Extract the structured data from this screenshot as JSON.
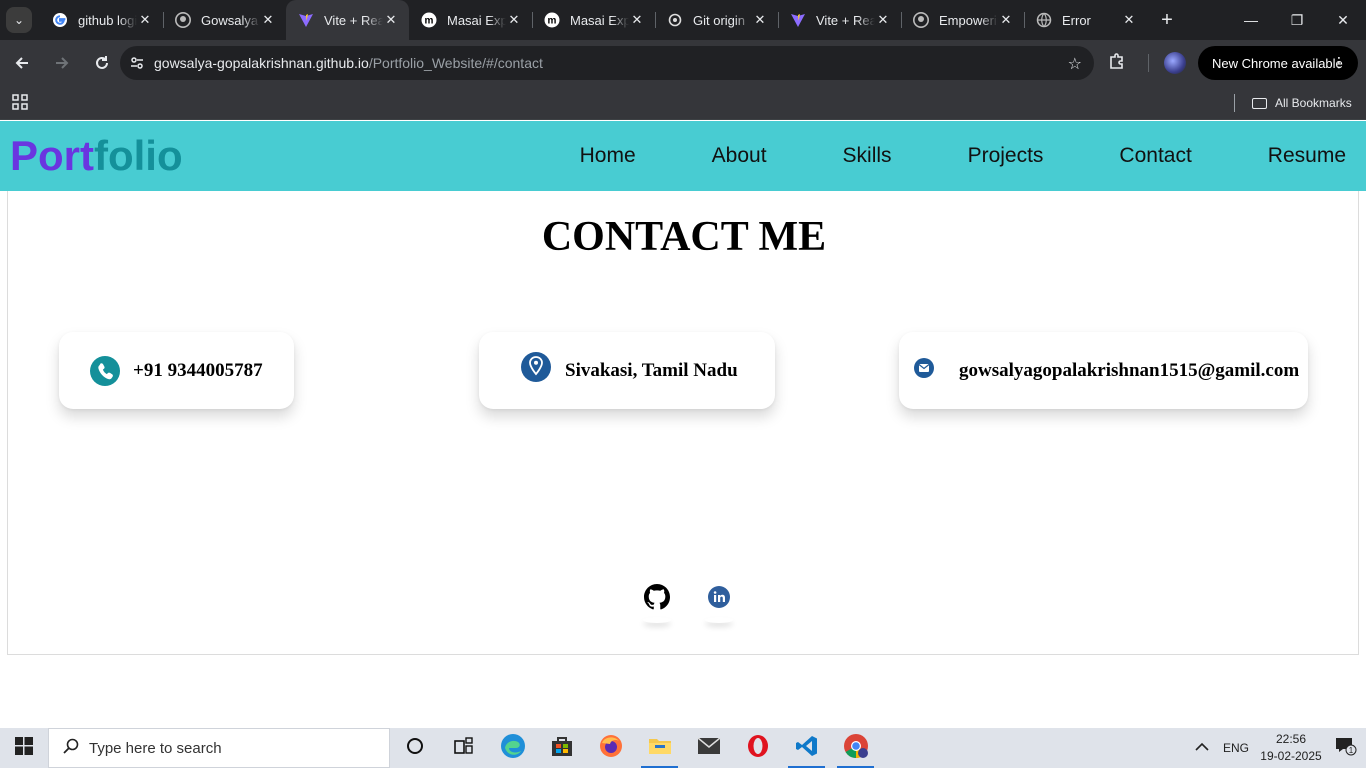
{
  "browser": {
    "tabs": [
      {
        "title": "github login",
        "favicon": "google-icon",
        "active": false
      },
      {
        "title": "Gowsalya",
        "favicon": "github-icon",
        "active": false
      },
      {
        "title": "Vite + React",
        "favicon": "vite-icon",
        "active": true
      },
      {
        "title": "Masai Experience",
        "favicon": "masai-icon",
        "active": false
      },
      {
        "title": "Masai Experience",
        "favicon": "masai-icon",
        "active": false
      },
      {
        "title": "Git origin",
        "favicon": "openai-icon",
        "active": false
      },
      {
        "title": "Vite + React",
        "favicon": "vite-icon",
        "active": false
      },
      {
        "title": "Empowering",
        "favicon": "github-icon",
        "active": false
      },
      {
        "title": "Error",
        "favicon": "globe-icon",
        "active": false
      }
    ],
    "url_host": "gowsalya-gopalakrishnan.github.io",
    "url_path": "/Portfolio_Website/#/contact",
    "update_label": "New Chrome available",
    "bookmarks_label": "All Bookmarks"
  },
  "site": {
    "logo_part1": "Port",
    "logo_part2": "folio",
    "nav": [
      "Home",
      "About",
      "Skills",
      "Projects",
      "Contact",
      "Resume"
    ],
    "heading": "CONTACT ME",
    "contacts": {
      "phone": "+91 9344005787",
      "location": "Sivakasi, Tamil Nadu",
      "email": "gowsalyagopalakrishnan1515@gamil.com"
    },
    "colors": {
      "nav_bg": "#48ccd2",
      "logo_port": "#6a35e0",
      "logo_folio": "#14909a",
      "phone_icon": "#14909a",
      "location_icon": "#1f5a99",
      "email_icon": "#1f5a99"
    }
  },
  "taskbar": {
    "search_placeholder": "Type here to search",
    "language": "ENG",
    "time": "22:56",
    "date": "19-02-2025",
    "notification_count": "1"
  }
}
